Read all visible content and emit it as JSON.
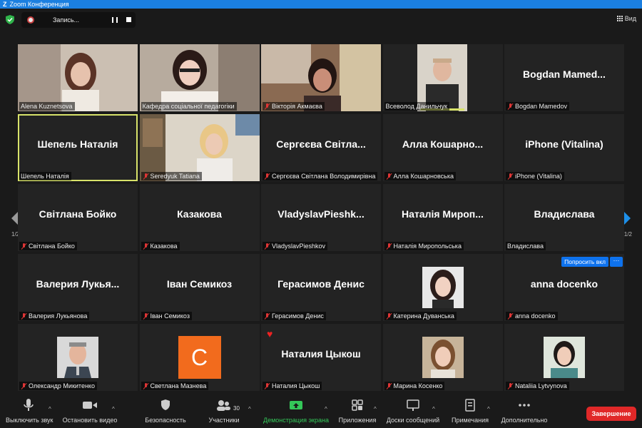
{
  "window": {
    "title": "Zoom Конференция",
    "logo": "Z"
  },
  "topbar": {
    "recording_label": "Запись...",
    "view_label": "Вид"
  },
  "pagination": {
    "left": "1/2",
    "right": "1/2"
  },
  "participants": [
    {
      "label": "Alena Kuznetsova",
      "muted": false,
      "type": "video"
    },
    {
      "label": "Кафедра соціальної педагогіки",
      "muted": false,
      "type": "video"
    },
    {
      "label": "Вікторія Акмаєва",
      "muted": true,
      "type": "video"
    },
    {
      "label": "Всеволод Данильчук",
      "muted": false,
      "type": "video"
    },
    {
      "name": "Bogdan  Mamed...",
      "label": "Bogdan Mamedov",
      "muted": true,
      "type": "name"
    },
    {
      "name": "Шепель Наталія",
      "label": "Шепель Наталія",
      "muted": false,
      "type": "name",
      "active": true
    },
    {
      "label": "Seredyuk Tatiana",
      "muted": true,
      "type": "video"
    },
    {
      "name": "Сергєєва Світла...",
      "label": "Сергєєва Світлана Володимирівна",
      "muted": true,
      "type": "name"
    },
    {
      "name": "Алла  Кошарно...",
      "label": "Алла Кошарновська",
      "muted": true,
      "type": "name"
    },
    {
      "name": "iPhone (Vitalina)",
      "label": "iPhone (Vitalina)",
      "muted": true,
      "type": "name"
    },
    {
      "name": "Світлана Бойко",
      "label": "Світлана Бойко",
      "muted": true,
      "type": "name"
    },
    {
      "name": "Казакова",
      "label": "Казакова",
      "muted": true,
      "type": "name"
    },
    {
      "name": "VladyslavPieshk...",
      "label": "VladyslavPieshkov",
      "muted": true,
      "type": "name"
    },
    {
      "name": "Наталія  Мироп...",
      "label": "Наталія Миропольська",
      "muted": true,
      "type": "name"
    },
    {
      "name": "Владислава",
      "label": "Владислава",
      "muted": false,
      "type": "name"
    },
    {
      "name": "Валерия  Лукья...",
      "label": "Валерия Лукьянова",
      "muted": true,
      "type": "name"
    },
    {
      "name": "Іван Семикоз",
      "label": "Іван Семикоз",
      "muted": true,
      "type": "name"
    },
    {
      "name": "Герасимов Денис",
      "label": "Герасимов Денис",
      "muted": true,
      "type": "name"
    },
    {
      "label": "Катерина Дуванська",
      "muted": true,
      "type": "photo"
    },
    {
      "name": "anna docenko",
      "label": "anna docenko",
      "muted": true,
      "type": "name",
      "ask": "Попросить вкл",
      "more": "···"
    },
    {
      "label": "Олександр Микитенко",
      "muted": true,
      "type": "photo"
    },
    {
      "label": "Светлана Мазнева",
      "muted": true,
      "type": "letter",
      "letter": "C"
    },
    {
      "name": "Наталия Цыкош",
      "label": "Наталия Цыкош",
      "muted": true,
      "type": "name",
      "heart": "♥"
    },
    {
      "label": "Марина Косенко",
      "muted": true,
      "type": "photo"
    },
    {
      "label": "Nataliia Lytvynova",
      "muted": true,
      "type": "photo"
    }
  ],
  "toolbar": {
    "mute": "Выключить звук",
    "video": "Остановить видео",
    "security": "Безопасность",
    "participants": "Участники",
    "participants_count": "30",
    "share": "Демонстрация экрана",
    "apps": "Приложения",
    "whiteboards": "Доски сообщений",
    "notes": "Примечания",
    "more": "Дополнительно",
    "end": "Завершение"
  },
  "colors": {
    "accent": "#0e72ed",
    "title_bar": "#1b7fe0",
    "end": "#e02828",
    "share_green": "#34c759",
    "active_speaker": "#d8e36a"
  }
}
